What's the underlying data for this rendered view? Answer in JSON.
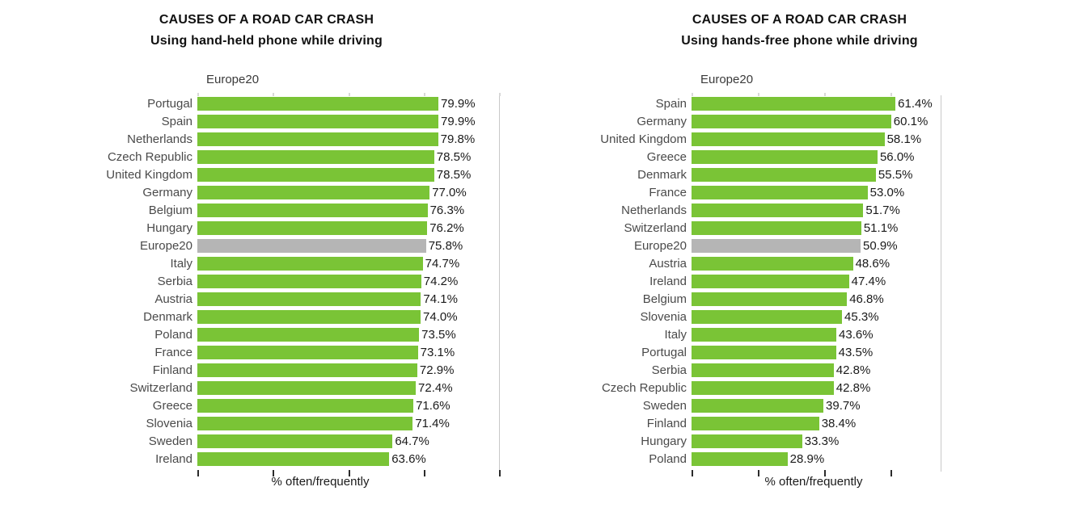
{
  "colors": {
    "bar": "#7ac436",
    "highlight": "#b5b5b5",
    "label": "#4a4a4a",
    "value": "#1a1a1a",
    "axis": "#c9c9c9"
  },
  "panels": [
    {
      "title_main": "CAUSES OF A ROAD CAR CRASH",
      "title_sub": "Using hand-held phone while driving",
      "note": "Europe20",
      "axis_title": "% often/frequently"
    },
    {
      "title_main": "CAUSES OF A ROAD CAR CRASH",
      "title_sub": "Using hands-free phone while driving",
      "note": "Europe20",
      "axis_title": "% often/frequently"
    }
  ],
  "chart_data": [
    {
      "type": "bar",
      "orientation": "horizontal",
      "title": "CAUSES OF A ROAD CAR CRASH",
      "subtitle": "Using hand-held phone while driving",
      "xlabel": "% often/frequently",
      "ylabel": "",
      "xlim": [
        0,
        100
      ],
      "xticks": [
        0,
        25,
        50,
        75,
        100
      ],
      "xticklabels": [
        "",
        "",
        "",
        "",
        ""
      ],
      "grid": false,
      "legend": null,
      "annotation": "Europe20",
      "highlight_category": "Europe20",
      "value_suffix": "%",
      "categories": [
        "Portugal",
        "Spain",
        "Netherlands",
        "Czech Republic",
        "United Kingdom",
        "Germany",
        "Belgium",
        "Hungary",
        "Europe20",
        "Italy",
        "Serbia",
        "Austria",
        "Denmark",
        "Poland",
        "France",
        "Finland",
        "Switzerland",
        "Greece",
        "Slovenia",
        "Sweden",
        "Ireland"
      ],
      "values": [
        79.9,
        79.9,
        79.8,
        78.5,
        78.5,
        77.0,
        76.3,
        76.2,
        75.8,
        74.7,
        74.2,
        74.1,
        74.0,
        73.5,
        73.1,
        72.9,
        72.4,
        71.6,
        71.4,
        64.7,
        63.6
      ],
      "labels": [
        "79.9%",
        "79.9%",
        "79.8%",
        "78.5%",
        "78.5%",
        "77.0%",
        "76.3%",
        "76.2%",
        "75.8%",
        "74.7%",
        "74.2%",
        "74.1%",
        "74.0%",
        "73.5%",
        "73.1%",
        "72.9%",
        "72.4%",
        "71.6%",
        "71.4%",
        "64.7%",
        "63.6%"
      ]
    },
    {
      "type": "bar",
      "orientation": "horizontal",
      "title": "CAUSES OF A ROAD CAR CRASH",
      "subtitle": "Using hands-free phone while driving",
      "xlabel": "% often/frequently",
      "ylabel": "",
      "xlim": [
        0,
        75
      ],
      "xticks": [
        0,
        20,
        40,
        60
      ],
      "xticklabels": [
        "",
        "",
        "",
        ""
      ],
      "grid": false,
      "legend": null,
      "annotation": "Europe20",
      "highlight_category": "Europe20",
      "value_suffix": "%",
      "categories": [
        "Spain",
        "Germany",
        "United Kingdom",
        "Greece",
        "Denmark",
        "France",
        "Netherlands",
        "Switzerland",
        "Europe20",
        "Austria",
        "Ireland",
        "Belgium",
        "Slovenia",
        "Italy",
        "Portugal",
        "Serbia",
        "Czech Republic",
        "Sweden",
        "Finland",
        "Hungary",
        "Poland"
      ],
      "values": [
        61.4,
        60.1,
        58.1,
        56.0,
        55.5,
        53.0,
        51.7,
        51.1,
        50.9,
        48.6,
        47.4,
        46.8,
        45.3,
        43.6,
        43.5,
        42.8,
        42.8,
        39.7,
        38.4,
        33.3,
        28.9
      ],
      "labels": [
        "61.4%",
        "60.1%",
        "58.1%",
        "56.0%",
        "55.5%",
        "53.0%",
        "51.7%",
        "51.1%",
        "50.9%",
        "48.6%",
        "47.4%",
        "46.8%",
        "45.3%",
        "43.6%",
        "43.5%",
        "42.8%",
        "42.8%",
        "39.7%",
        "38.4%",
        "33.3%",
        "28.9%"
      ]
    }
  ]
}
